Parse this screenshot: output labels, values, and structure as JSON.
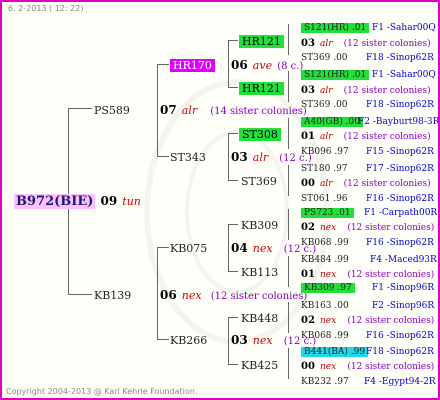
{
  "date": "6. 2-2013 ( 12: 22)",
  "copyright": "Copyright 2004-2013 @ Karl Kehrle Foundation.",
  "root": {
    "name": "B972(BIE)",
    "num": "09",
    "trait": "tun"
  },
  "father": {
    "name": "PS589",
    "num": "07",
    "trait": "alr",
    "note": "(14 sister colonies)"
  },
  "mother": {
    "name": "KB139",
    "num": "06",
    "trait": "nex",
    "note": "(12 sister colonies)"
  },
  "gen2": {
    "hr170": {
      "name": "HR170",
      "num": "06",
      "trait": "ave",
      "note": "(8 c.)"
    },
    "st343": {
      "name": "ST343",
      "num": "03",
      "trait": "alr",
      "note": "(12 c.)"
    },
    "kb075": {
      "name": "KB075",
      "num": "04",
      "trait": "nex",
      "note": "(12 c.)"
    },
    "kb266": {
      "name": "KB266",
      "num": "03",
      "trait": "nex",
      "note": "(12 c.)"
    }
  },
  "gen3": [
    "HR121",
    "HR121",
    "ST308",
    "ST369",
    "KB309",
    "KB113",
    "KB448",
    "KB425"
  ],
  "gen4": [
    {
      "top": "S121(HR) .01",
      "topOrigin": "F1 -Sahar00Q",
      "mid": "03",
      "trait": "alr",
      "note": "(12 sister colonies)",
      "bottom": "ST369 .00",
      "bottomOrigin": "F18 -Sinop62R"
    },
    {
      "top": "S121(HR) .01",
      "topOrigin": "F1 -Sahar00Q",
      "mid": "03",
      "trait": "alr",
      "note": "(12 sister colonies)",
      "bottom": "ST369 .00",
      "bottomOrigin": "F18 -Sinop62R"
    },
    {
      "top": "A40(GB) .00",
      "topOrigin": "F2 -Bayburt98-3R",
      "mid": "01",
      "trait": "alr",
      "note": "(12 sister colonies)",
      "bottom": "KB096 .97",
      "bottomOrigin": "F15 -Sinop62R"
    },
    {
      "top": "ST180 .97",
      "topOrigin": "F17 -Sinop62R",
      "mid": "00",
      "trait": "alr",
      "note": "(12 sister colonies)",
      "bottom": "ST061 .96",
      "bottomOrigin": "F16 -Sinop62R"
    },
    {
      "top": "PS723 .01",
      "topOrigin": "F1 -Carpath00R",
      "mid": "02",
      "trait": "nex",
      "note": "(12 sister colonies)",
      "bottom": "KB068 .99",
      "bottomOrigin": "F16 -Sinop62R"
    },
    {
      "top": "KB484 .99",
      "topOrigin": "F4 -Maced93R",
      "mid": "01",
      "trait": "nex",
      "note": "(12 sister colonies)",
      "bottom": "KB309 .97",
      "bottomOrigin": "F1 -Sinop96R"
    },
    {
      "top": "KB163 .00",
      "topOrigin": "F2 -Sinop96R",
      "mid": "02",
      "trait": "nex",
      "note": "(12 sister colonies)",
      "bottom": "KB068 .99",
      "bottomOrigin": "F16 -Sinop62R"
    },
    {
      "top": "B441(BA) .99",
      "topOrigin": "F18 -Sinop62R",
      "mid": "00",
      "trait": "nex",
      "note": "(12 sister colonies)",
      "bottom": "KB232 .97",
      "bottomOrigin": "F4 -Egypt94-2R"
    }
  ]
}
